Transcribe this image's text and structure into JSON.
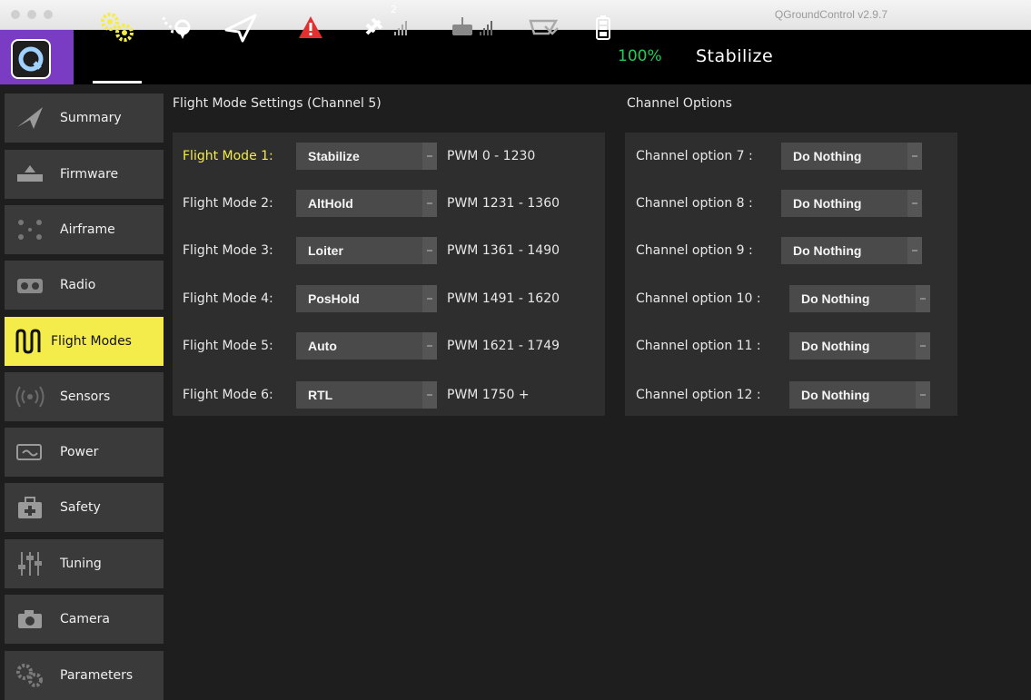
{
  "window": {
    "title": "QGroundControl v2.9.7"
  },
  "toolbar": {
    "battery_percent": "100%",
    "flight_mode": "Stabilize",
    "gps_sat_count": "2",
    "icons": [
      "settings-gears-icon",
      "plan-route-icon",
      "fly-plane-icon",
      "warning-icon",
      "gps-signal-icon",
      "rc-signal-icon",
      "telemetry-icon",
      "battery-icon"
    ],
    "colors": {
      "accent": "#7b3cc4",
      "active": "#f3ec4a",
      "battery": "#22cc55"
    }
  },
  "sidebar": {
    "items": [
      {
        "label": "Summary",
        "icon": "summary-plane-icon"
      },
      {
        "label": "Firmware",
        "icon": "firmware-icon"
      },
      {
        "label": "Airframe",
        "icon": "airframe-icon"
      },
      {
        "label": "Radio",
        "icon": "radio-icon"
      },
      {
        "label": "Flight Modes",
        "icon": "flight-modes-icon",
        "active": true
      },
      {
        "label": "Sensors",
        "icon": "sensors-icon"
      },
      {
        "label": "Power",
        "icon": "power-icon"
      },
      {
        "label": "Safety",
        "icon": "safety-icon"
      },
      {
        "label": "Tuning",
        "icon": "tuning-sliders-icon"
      },
      {
        "label": "Camera",
        "icon": "camera-icon"
      },
      {
        "label": "Parameters",
        "icon": "parameters-gears-icon"
      }
    ]
  },
  "flight_modes": {
    "title": "Flight Mode Settings (Channel 5)",
    "rows": [
      {
        "label": "Flight Mode 1:",
        "value": "Stabilize",
        "pwm": "PWM 0 - 1230",
        "highlight": true
      },
      {
        "label": "Flight Mode 2:",
        "value": "AltHold",
        "pwm": "PWM 1231 - 1360"
      },
      {
        "label": "Flight Mode 3:",
        "value": "Loiter",
        "pwm": "PWM 1361 - 1490"
      },
      {
        "label": "Flight Mode 4:",
        "value": "PosHold",
        "pwm": "PWM 1491 - 1620"
      },
      {
        "label": "Flight Mode 5:",
        "value": "Auto",
        "pwm": "PWM 1621 - 1749"
      },
      {
        "label": "Flight Mode 6:",
        "value": "RTL",
        "pwm": "PWM 1750 +"
      }
    ]
  },
  "channel_options": {
    "title": "Channel Options",
    "rows": [
      {
        "label": "Channel option 7 :",
        "value": "Do Nothing"
      },
      {
        "label": "Channel option 8 :",
        "value": "Do Nothing"
      },
      {
        "label": "Channel option 9 :",
        "value": "Do Nothing"
      },
      {
        "label": "Channel option 10 :",
        "value": "Do Nothing"
      },
      {
        "label": "Channel option 11 :",
        "value": "Do Nothing"
      },
      {
        "label": "Channel option 12 :",
        "value": "Do Nothing"
      }
    ]
  }
}
